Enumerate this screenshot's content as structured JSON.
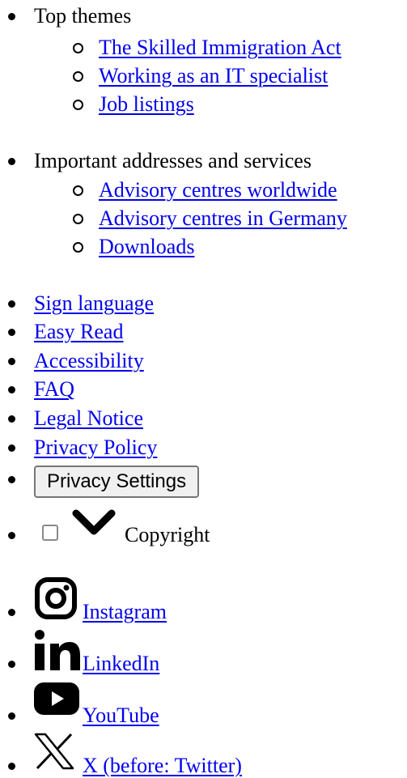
{
  "top_themes": {
    "heading": "Top themes",
    "links": [
      "The Skilled Immigration Act",
      "Working as an IT specialist",
      "Job listings"
    ]
  },
  "addresses": {
    "heading": "Important addresses and services",
    "links": [
      "Advisory centres worldwide",
      "Advisory centres in Germany",
      "Downloads"
    ]
  },
  "footer_links": [
    "Sign language",
    "Easy Read",
    "Accessibility",
    "FAQ",
    "Legal Notice",
    "Privacy Policy"
  ],
  "privacy_settings_label": "Privacy Settings",
  "copyright_label": "Copyright",
  "social": [
    {
      "icon": "instagram-icon",
      "label": "Instagram"
    },
    {
      "icon": "linkedin-icon",
      "label": "LinkedIn"
    },
    {
      "icon": "youtube-icon",
      "label": "YouTube"
    },
    {
      "icon": "x-icon",
      "label": "X (before: Twitter)"
    }
  ],
  "colors": {
    "link": "#0000ee",
    "text": "#000000",
    "button_bg": "#f0f0f0"
  }
}
